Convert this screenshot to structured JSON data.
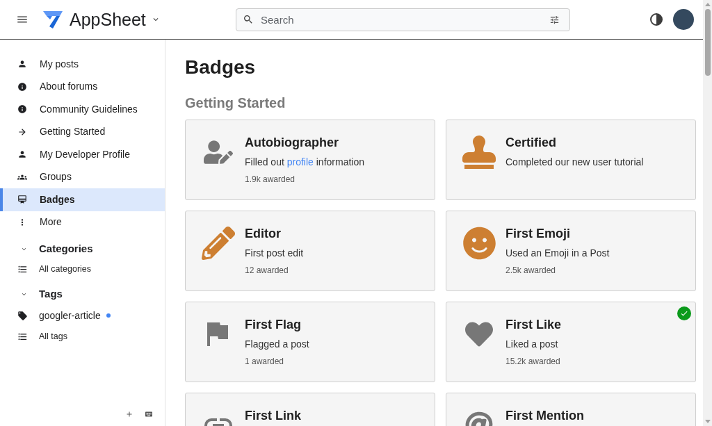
{
  "header": {
    "title": "AppSheet",
    "search": {
      "placeholder": "Search"
    }
  },
  "sidebar": {
    "items": [
      {
        "label": "My posts",
        "selected": false
      },
      {
        "label": "About forums",
        "selected": false
      },
      {
        "label": "Community Guidelines",
        "selected": false
      },
      {
        "label": "Getting Started",
        "selected": false
      },
      {
        "label": "My Developer Profile",
        "selected": false
      },
      {
        "label": "Groups",
        "selected": false
      },
      {
        "label": "Badges",
        "selected": true
      },
      {
        "label": "More",
        "selected": false
      }
    ],
    "sections": [
      {
        "title": "Categories",
        "expanded": true,
        "items": [
          {
            "kind": "all",
            "label": "All categories",
            "new": false
          }
        ]
      },
      {
        "title": "Tags",
        "expanded": true,
        "items": [
          {
            "kind": "tag",
            "label": "googler-article",
            "new": true
          },
          {
            "kind": "all",
            "label": "All tags",
            "new": false
          }
        ]
      }
    ]
  },
  "main": {
    "title": "Badges",
    "groups": [
      {
        "title": "Getting Started",
        "badges": [
          {
            "title": "Autobiographer",
            "color": "#777777",
            "earned": false,
            "description": [
              {
                "kind": "text",
                "text": "Filled out "
              },
              {
                "kind": "link",
                "text": "profile"
              },
              {
                "kind": "text",
                "text": " information"
              }
            ],
            "awarded": "1.9k awarded"
          },
          {
            "title": "Certified",
            "color": "#cd7f32",
            "earned": false,
            "description": [
              {
                "kind": "text",
                "text": "Completed our new user tutorial"
              }
            ]
          },
          {
            "title": "Editor",
            "color": "#cd7f32",
            "earned": false,
            "description": [
              {
                "kind": "text",
                "text": "First post edit"
              }
            ],
            "awarded": "12 awarded"
          },
          {
            "title": "First Emoji",
            "color": "#cd7f32",
            "earned": false,
            "description": [
              {
                "kind": "text",
                "text": "Used an Emoji in a Post"
              }
            ],
            "awarded": "2.5k awarded"
          },
          {
            "title": "First Flag",
            "color": "#777777",
            "earned": false,
            "description": [
              {
                "kind": "text",
                "text": "Flagged a post"
              }
            ],
            "awarded": "1 awarded"
          },
          {
            "title": "First Like",
            "color": "#777777",
            "earned": true,
            "description": [
              {
                "kind": "text",
                "text": "Liked a post"
              }
            ],
            "awarded": "15.2k awarded"
          },
          {
            "title": "First Link",
            "color": "#777777",
            "earned": false
          },
          {
            "title": "First Mention",
            "color": "#777777",
            "earned": false
          }
        ]
      }
    ]
  }
}
